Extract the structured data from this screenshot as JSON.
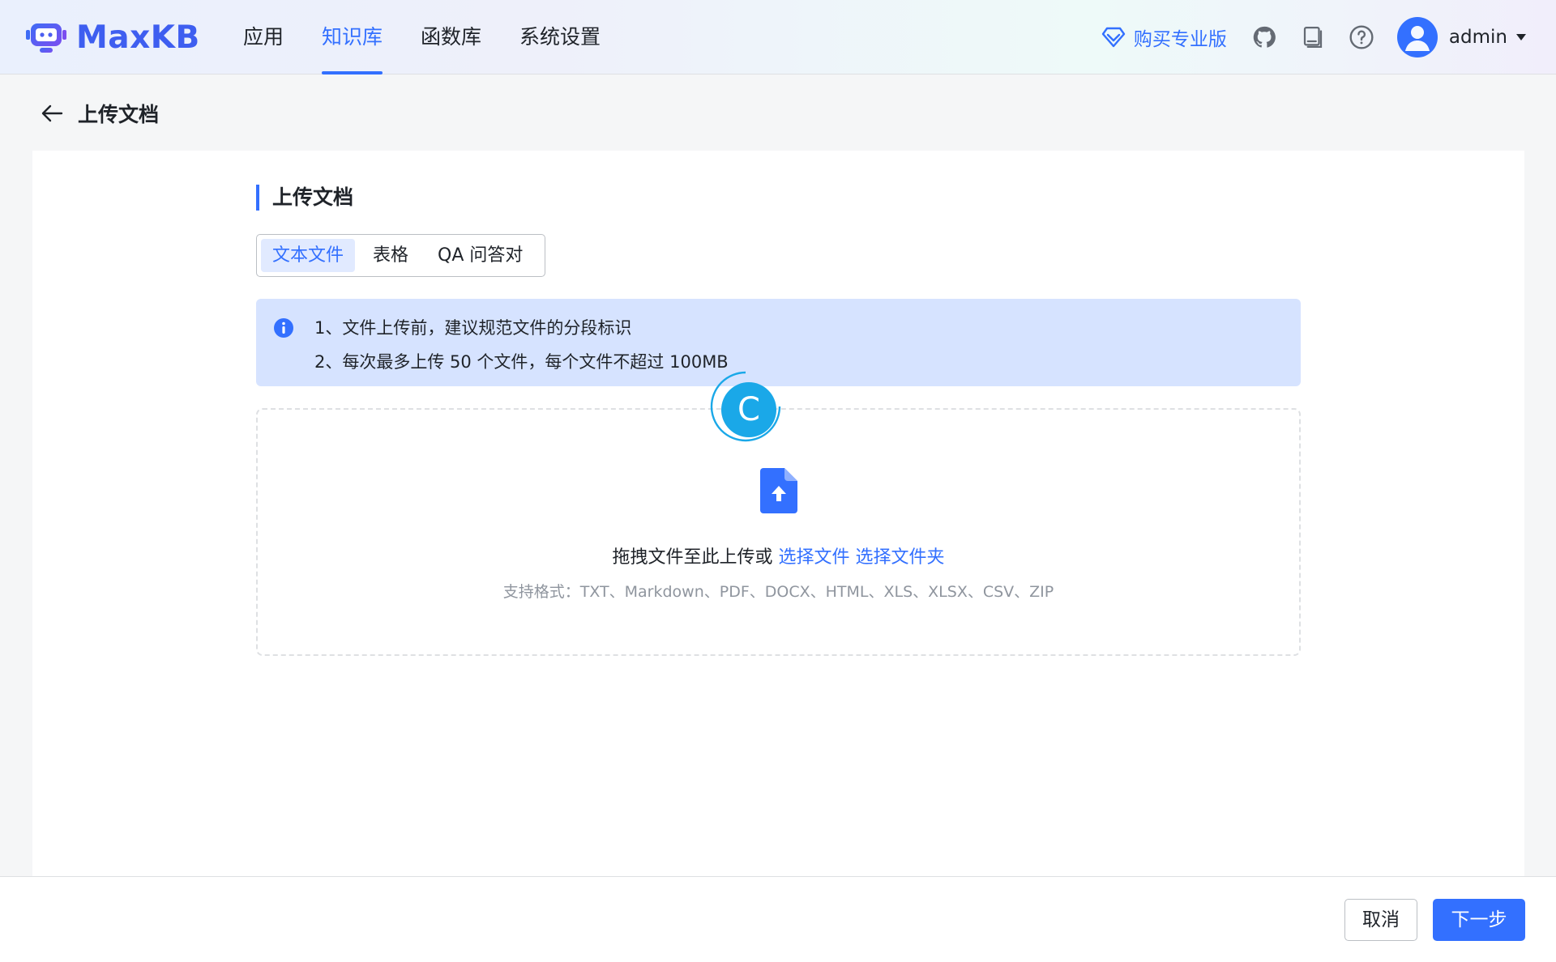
{
  "app": {
    "brand": "MaxKB"
  },
  "nav": {
    "items": [
      {
        "label": "应用",
        "active": false
      },
      {
        "label": "知识库",
        "active": true
      },
      {
        "label": "函数库",
        "active": false
      },
      {
        "label": "系统设置",
        "active": false
      }
    ]
  },
  "header": {
    "buy_pro_label": "购买专业版",
    "icons": [
      "diamond-icon",
      "github-icon",
      "user-manual-icon",
      "help-icon"
    ],
    "user_name": "admin"
  },
  "page": {
    "title": "上传文档"
  },
  "section": {
    "title": "上传文档"
  },
  "tabs": [
    {
      "label": "文本文件",
      "active": true
    },
    {
      "label": "表格",
      "active": false
    },
    {
      "label": "QA 问答对",
      "active": false
    }
  ],
  "alert": {
    "lines": [
      "1、文件上传前，建议规范文件的分段标识",
      "2、每次最多上传 50 个文件，每个文件不超过 100MB"
    ]
  },
  "dropzone": {
    "prompt": "拖拽文件至此上传或",
    "select_file": "选择文件",
    "select_folder": "选择文件夹",
    "formats": "支持格式：TXT、Markdown、PDF、DOCX、HTML、XLS、XLSX、CSV、ZIP"
  },
  "overlay": {
    "letter": "C"
  },
  "footer": {
    "cancel_label": "取消",
    "next_label": "下一步"
  },
  "colors": {
    "primary": "#3370ff",
    "alert_bg": "#d6e3ff",
    "text": "#1f2329",
    "muted": "#8f959e"
  }
}
